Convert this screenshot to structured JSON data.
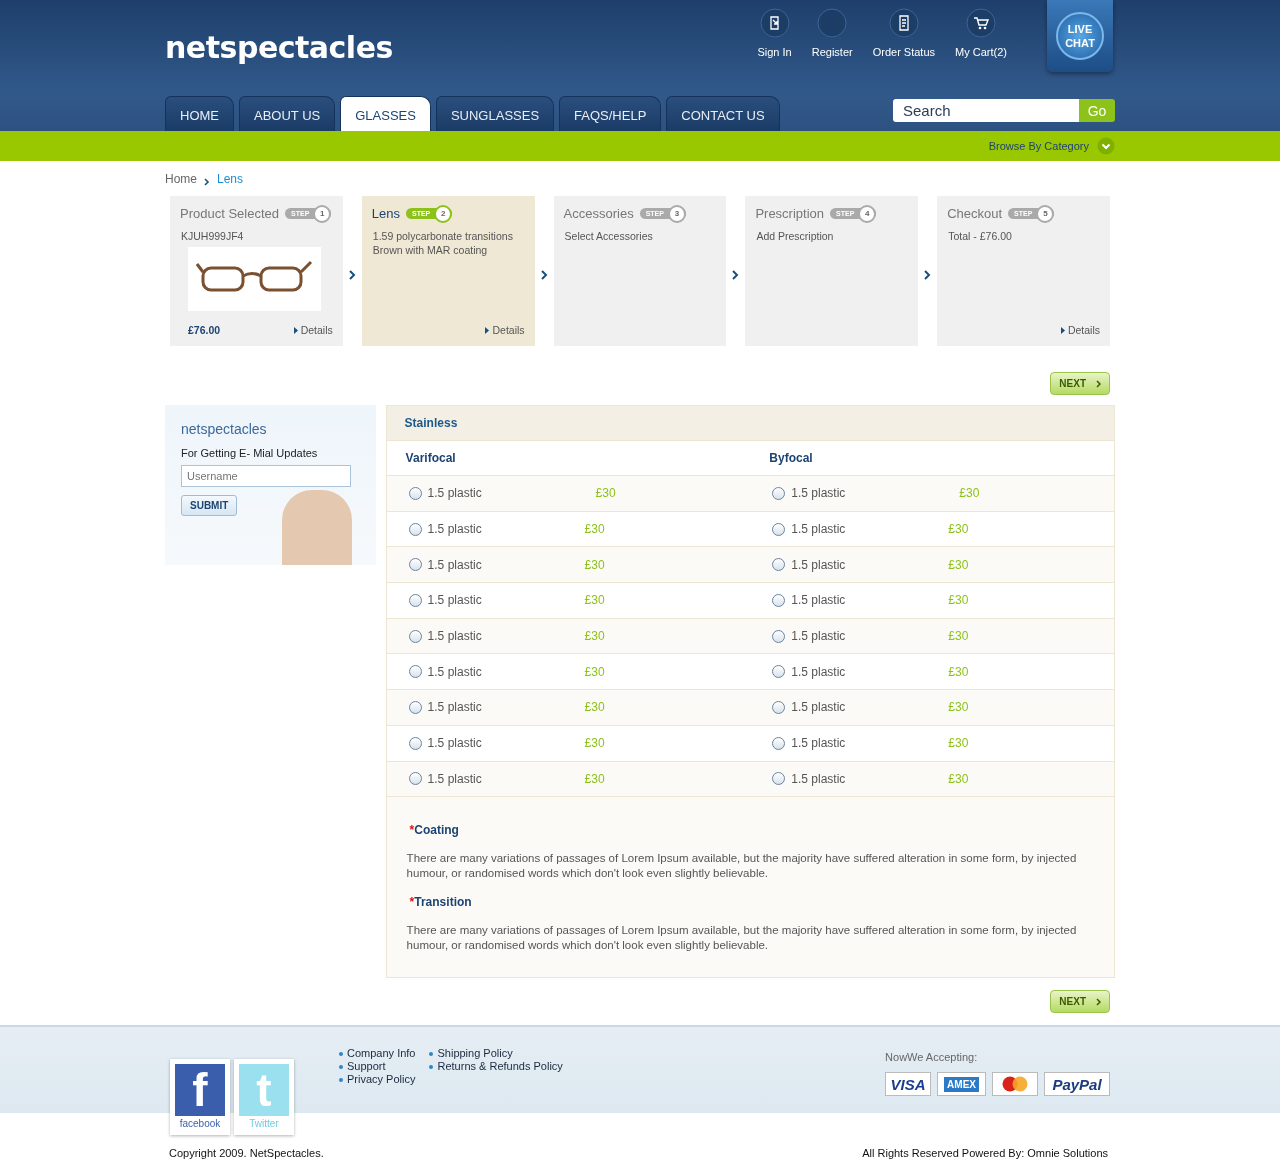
{
  "logo": "netspectacles",
  "top_links": [
    {
      "label": "Sign In",
      "kind": "signin"
    },
    {
      "label": "Register",
      "kind": "register"
    },
    {
      "label": "Order Status",
      "kind": "order"
    },
    {
      "label": "My Cart(2)",
      "kind": "cart"
    }
  ],
  "live_chat": [
    "LIVE",
    "CHAT"
  ],
  "nav": [
    {
      "label": "HOME",
      "selected": false
    },
    {
      "label": "ABOUT US",
      "selected": false
    },
    {
      "label": "GLASSES",
      "selected": true
    },
    {
      "label": "SUNGLASSES",
      "selected": false
    },
    {
      "label": "FAQS/HELP",
      "selected": false
    },
    {
      "label": "CONTACT US",
      "selected": false
    }
  ],
  "search": {
    "placeholder": "Search",
    "button": "Go"
  },
  "browse": "Browse By Category",
  "breadcrumb": [
    "Home",
    "Lens"
  ],
  "steps": [
    {
      "title": "Product Selected",
      "step": "STEP",
      "number": "1",
      "selected": false,
      "lines": [
        "KJUH999JF4"
      ],
      "photo": true,
      "price": "£76.00",
      "details": "Details"
    },
    {
      "title": "Lens",
      "step": "STEP",
      "number": "2",
      "selected": true,
      "lines": [
        "1.59 polycarbonate transitions Brown with MAR coating"
      ],
      "details": "Details"
    },
    {
      "title": "Accessories",
      "step": "STEP",
      "number": "3",
      "selected": false,
      "lines": [
        "Select Accessories"
      ]
    },
    {
      "title": "Prescription",
      "step": "STEP",
      "number": "4",
      "selected": false,
      "lines": [
        "Add Prescription"
      ]
    },
    {
      "title": "Checkout",
      "step": "STEP",
      "number": "5",
      "selected": false,
      "lines": [
        "Total - £76.00"
      ],
      "details": "Details"
    }
  ],
  "next_top": "NEXT",
  "newsletter": {
    "title": "netspectacles",
    "subtitle": "For Getting E- Mial Updates",
    "placeholder": "Username",
    "button": "SUBMIT"
  },
  "lens": {
    "heading": "Stainless",
    "columns": [
      "Varifocal",
      "Byfocal"
    ],
    "rows": [
      [
        {
          "label": "1.5 plastic",
          "price": "£30",
          "selected": false
        },
        {
          "label": "1.5 plastic",
          "price": "£30",
          "selected": false
        }
      ],
      [
        {
          "label": "1.5 plastic",
          "price": "£30",
          "selected": false
        },
        {
          "label": "1.5 plastic",
          "price": "£30",
          "selected": false
        }
      ],
      [
        {
          "label": "1.5 plastic",
          "price": "£30",
          "selected": false
        },
        {
          "label": "1.5 plastic",
          "price": "£30",
          "selected": false
        }
      ],
      [
        {
          "label": "1.5 plastic",
          "price": "£30",
          "selected": false
        },
        {
          "label": "1.5 plastic",
          "price": "£30",
          "selected": false
        }
      ],
      [
        {
          "label": "1.5 plastic",
          "price": "£30",
          "selected": false
        },
        {
          "label": "1.5 plastic",
          "price": "£30",
          "selected": false
        }
      ],
      [
        {
          "label": "1.5 plastic",
          "price": "£30",
          "selected": false
        },
        {
          "label": "1.5 plastic",
          "price": "£30",
          "selected": false
        }
      ],
      [
        {
          "label": "1.5 plastic",
          "price": "£30",
          "selected": false
        },
        {
          "label": "1.5 plastic",
          "price": "£30",
          "selected": false
        }
      ],
      [
        {
          "label": "1.5 plastic",
          "price": "£30",
          "selected": false
        },
        {
          "label": "1.5 plastic",
          "price": "£30",
          "selected": false
        }
      ],
      [
        {
          "label": "1.5 plastic",
          "price": "£30",
          "selected": false
        },
        {
          "label": "1.5 plastic",
          "price": "£30",
          "selected": false
        }
      ]
    ],
    "notes": [
      {
        "marker": "*",
        "title": "Coating",
        "text": "There are many variations of passages of Lorem Ipsum available, but the majority have suffered alteration in some form, by injected humour, or randomised words which don't look even slightly believable."
      },
      {
        "marker": "*",
        "title": "Transition",
        "text": "There are many variations of passages of Lorem Ipsum available, but the majority have suffered alteration in some form, by injected humour, or randomised words which don't look even slightly believable."
      }
    ]
  },
  "next_bottom": "NEXT",
  "social": [
    {
      "glyph": "f",
      "label": "facebook",
      "kind": "facebook"
    },
    {
      "glyph": "t",
      "label": "Twitter",
      "kind": "twitter"
    }
  ],
  "footer_links": [
    [
      "Company Info",
      "Support",
      "Privacy Policy"
    ],
    [
      "Shipping Policy",
      "Returns & Refunds Policy"
    ]
  ],
  "accepting": "NowWe Accepting:",
  "cards": [
    {
      "kind": "visa",
      "label": "VISA"
    },
    {
      "kind": "amex",
      "label": "AMEX"
    },
    {
      "kind": "mastercard"
    },
    {
      "kind": "paypal",
      "label": "PayPal"
    }
  ],
  "copyright": "Copyright 2009. NetSpectacles.",
  "powered": "All Rights Reserved Powered By: Omnie Solutions"
}
